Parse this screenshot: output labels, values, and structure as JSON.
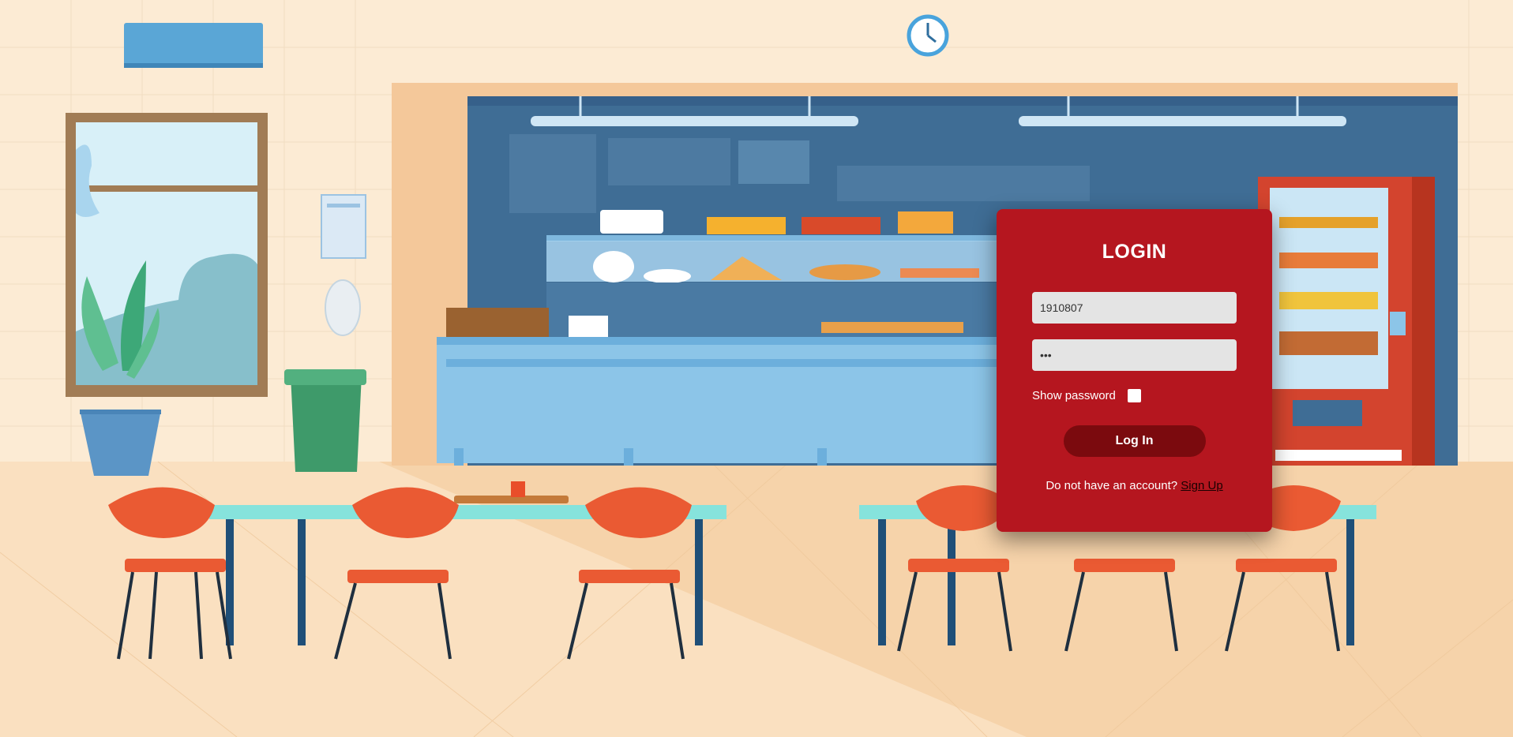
{
  "login": {
    "title": "LOGIN",
    "username_value": "1910807",
    "password_value": "•••",
    "show_password_label": "Show password",
    "show_password_checked": false,
    "submit_label": "Log In",
    "no_account_text": "Do not have an account?",
    "signup_label": "Sign Up"
  },
  "colors": {
    "card": "#b5161f",
    "button": "#7b0a0e",
    "field": "#e4e4e4"
  }
}
